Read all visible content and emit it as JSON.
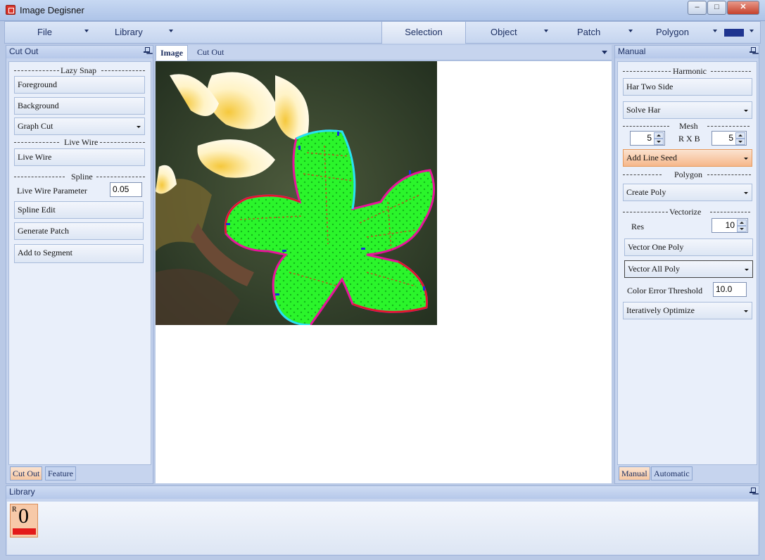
{
  "window": {
    "title": "Image Degisner",
    "min": "–",
    "max": "□",
    "close": "✕"
  },
  "menu": {
    "file": "File",
    "library": "Library",
    "selection": "Selection",
    "object": "Object",
    "patch": "Patch",
    "polygon": "Polygon",
    "accent_color": "#1f3590"
  },
  "left_panel": {
    "title": "Cut Out",
    "lazy_snap": "Lazy Snap",
    "foreground": "Foreground",
    "background": "Background",
    "graph_cut": "Graph Cut",
    "live_wire_section": "Live Wire",
    "live_wire": "Live Wire",
    "spline_section": "Spline",
    "live_wire_param_label": "Live Wire Parameter",
    "live_wire_param_value": "0.05",
    "spline_edit": "Spline Edit",
    "generate_patch": "Generate Patch",
    "add_to_segment": "Add to Segment",
    "tabs": [
      "Cut Out",
      "Feature"
    ]
  },
  "document": {
    "tabs": [
      "Image",
      "Cut Out"
    ]
  },
  "right_panel": {
    "title": "Manual",
    "harmonic": "Harmonic",
    "har_two_side": "Har Two Side",
    "solve_har": "Solve Har",
    "mesh": "Mesh",
    "rxb": "R X B",
    "mesh_r": "5",
    "mesh_b": "5",
    "add_line_seed": "Add Line Seed",
    "polygon_section": "Polygon",
    "create_poly": "Create Poly",
    "vectorize": "Vectorize",
    "res_label": "Res",
    "res_value": "10",
    "vector_one_poly": "Vector One Poly",
    "vector_all_poly": "Vector All Poly",
    "color_error_label": "Color Error Threshold",
    "color_error_value": "10.0",
    "iteratively_optimize": "Iteratively Optimize",
    "tabs": [
      "Manual",
      "Automatic"
    ]
  },
  "library": {
    "title": "Library",
    "item_prefix": "R",
    "item_label": "0"
  }
}
